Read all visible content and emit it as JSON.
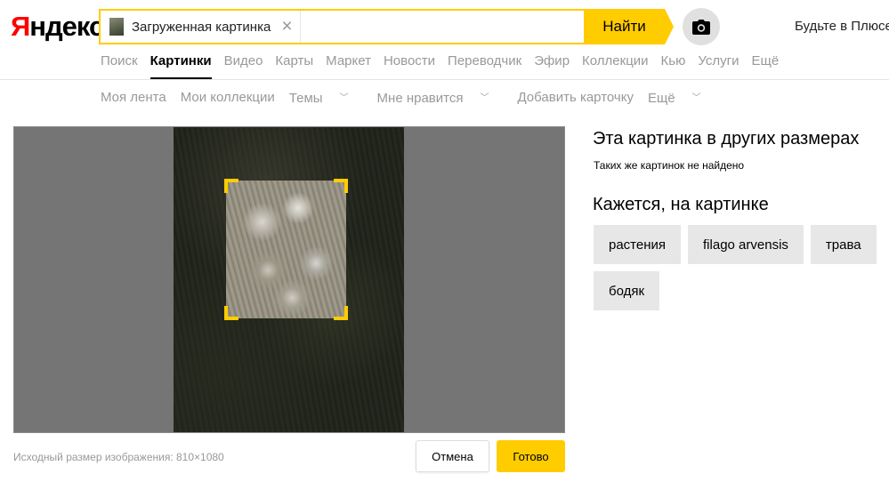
{
  "header": {
    "logo": {
      "first": "Я",
      "rest": "ндекс"
    },
    "search": {
      "chip_label": "Загруженная картинка",
      "find_label": "Найти"
    },
    "plus_link": "Будьте в Плюсе"
  },
  "services": [
    "Поиск",
    "Картинки",
    "Видео",
    "Карты",
    "Маркет",
    "Новости",
    "Переводчик",
    "Эфир",
    "Коллекции",
    "Кью",
    "Услуги",
    "Ещё"
  ],
  "active_service": "Картинки",
  "subnav": {
    "feed": "Моя лента",
    "collections": "Мои коллекции",
    "themes": "Темы",
    "liked": "Мне нравится",
    "add_card": "Добавить карточку",
    "more": "Ещё"
  },
  "editor": {
    "original_size": "Исходный размер изображения: 810×1080",
    "cancel_label": "Отмена",
    "done_label": "Готово"
  },
  "right_panel": {
    "sizes_title": "Эта картинка в других размерах",
    "sizes_note": "Таких же картинок не найдено",
    "tags_title": "Кажется, на картинке",
    "tags": [
      "растения",
      "filago arvensis",
      "трава",
      "бодяк"
    ]
  },
  "colors": {
    "accent": "#ffcc00",
    "logo_red": "#ff0000",
    "muted_text": "#999999",
    "tag_bg": "#e7e7e7"
  }
}
